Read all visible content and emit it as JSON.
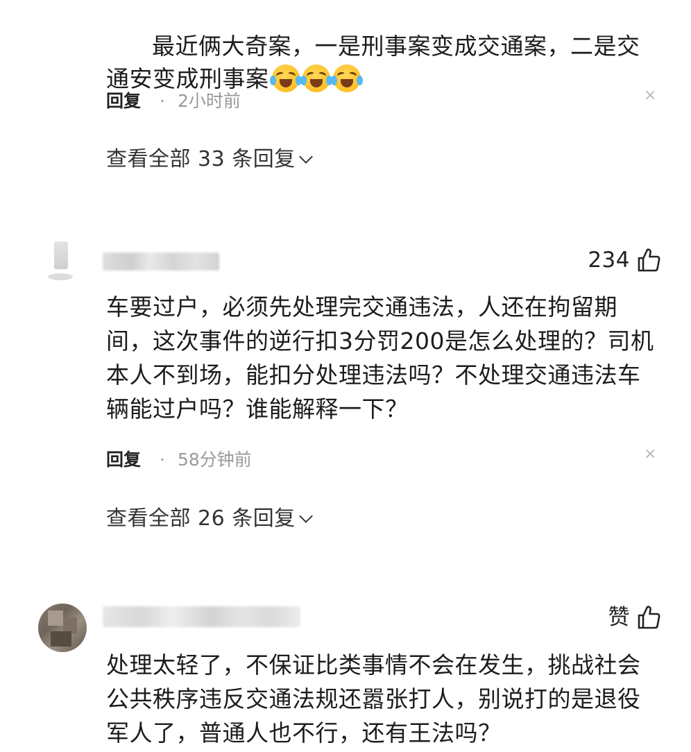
{
  "comments": [
    {
      "text": "最近俩大奇案，一是刑事案变成交通案，二是交通安变成刑事案",
      "emoji": [
        "laugh-cry-emoji",
        "laugh-cry-emoji",
        "laugh-cry-emoji"
      ],
      "reply_label": "回复",
      "dot": "·",
      "time": "2小时前",
      "close_label": "×",
      "view_replies": "查看全部 33 条回复"
    },
    {
      "like_count": "234",
      "text": "车要过户，必须先处理完交通违法，人还在拘留期间，这次事件的逆行扣3分罚200是怎么处理的？司机本人不到场，能扣分处理违法吗？不处理交通违法车辆能过户吗？谁能解释一下？",
      "reply_label": "回复",
      "dot": "·",
      "time": "58分钟前",
      "close_label": "×",
      "view_replies": "查看全部 26 条回复"
    },
    {
      "like_label": "赞",
      "text": "处理太轻了，不保证比类事情不会在发生，挑战社会公共秩序违反交通法规还嚣张打人，别说打的是退役军人了，普通人也不行，还有王法吗？"
    }
  ],
  "icons": {
    "like": "thumbs-up-icon",
    "chevron": "chevron-down-icon",
    "close": "close-icon"
  },
  "colors": {
    "text": "#1c1c1c",
    "meta": "#9a9a9a",
    "close": "#b8b8b8"
  }
}
